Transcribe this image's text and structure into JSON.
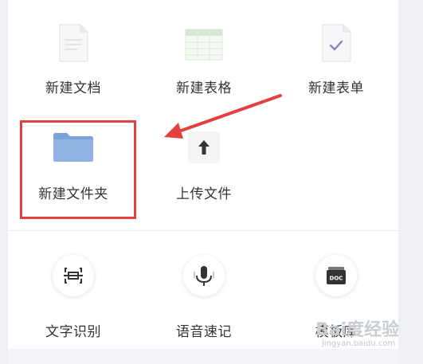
{
  "row1": [
    {
      "label": "新建文档",
      "icon": "doc-file-icon"
    },
    {
      "label": "新建表格",
      "icon": "spreadsheet-file-icon"
    },
    {
      "label": "新建表单",
      "icon": "form-file-icon"
    }
  ],
  "row2": [
    {
      "label": "新建文件夹",
      "icon": "folder-icon"
    },
    {
      "label": "上传文件",
      "icon": "upload-icon"
    }
  ],
  "row3": [
    {
      "label": "文字识别",
      "icon": "scan-icon"
    },
    {
      "label": "语音速记",
      "icon": "microphone-icon"
    },
    {
      "label": "模板库",
      "icon": "doc-template-icon",
      "badge": "DOC"
    }
  ],
  "colors": {
    "highlight": "#e5403f",
    "folder": "#8fb3e3",
    "spreadsheet": "#dfeedd",
    "check": "#8a7fc4"
  },
  "watermark": {
    "brand": "Bai度经验",
    "sub": "jingyan.baidu.com"
  }
}
